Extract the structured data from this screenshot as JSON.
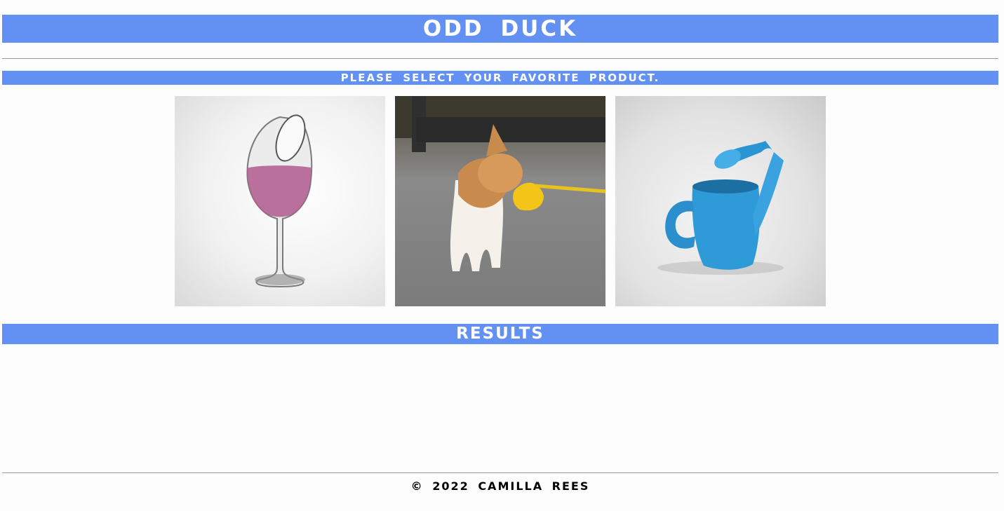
{
  "header": {
    "title": "Odd Duck"
  },
  "voting": {
    "prompt": "Please select your favorite product.",
    "products": [
      {
        "name": "wine-glass",
        "icon": "wine-glass-image"
      },
      {
        "name": "dog-duck",
        "icon": "dog-duck-muzzle-image"
      },
      {
        "name": "water-can",
        "icon": "watering-can-image"
      }
    ]
  },
  "results": {
    "heading": "Results"
  },
  "footer": {
    "copyright": "© 2022 Camilla Rees"
  },
  "colors": {
    "banner": "#6290f3",
    "banner_text": "#ffffff",
    "footer_text": "#000000"
  }
}
